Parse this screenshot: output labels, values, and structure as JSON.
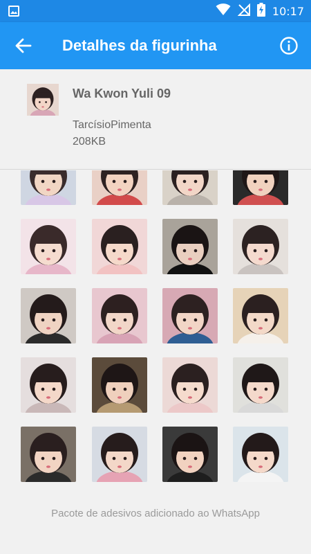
{
  "status_bar": {
    "time": "10:17"
  },
  "app_bar": {
    "title": "Detalhes da figurinha"
  },
  "pack": {
    "name": "Wa Kwon Yuli 09",
    "author": "TarcísioPimenta",
    "size": "208KB"
  },
  "footer": {
    "message": "Pacote de adesivos adicionado ao WhatsApp"
  },
  "colors": {
    "status_bar": "#1e88e5",
    "app_bar": "#2196f3",
    "background": "#f1f1f1",
    "text_secondary": "#666666"
  },
  "stickers": [
    {
      "bg": "#cfd6e2",
      "skin": "#f1d6c4",
      "hair": "#3a2c2c",
      "cloth": "#d8c7e6"
    },
    {
      "bg": "#e9d0c6",
      "skin": "#f3d3c1",
      "hair": "#2e2222",
      "cloth": "#d24b4b"
    },
    {
      "bg": "#d9d2c8",
      "skin": "#f2d6c7",
      "hair": "#2b2020",
      "cloth": "#b9b2aa"
    },
    {
      "bg": "#2a2a2a",
      "skin": "#f1d2bf",
      "hair": "#1f1717",
      "cloth": "#d05050"
    },
    {
      "bg": "#f3e3e8",
      "skin": "#f5dccf",
      "hair": "#3a2a2a",
      "cloth": "#e7b7c9"
    },
    {
      "bg": "#f1d7d7",
      "skin": "#f5d9ca",
      "hair": "#2a2020",
      "cloth": "#f2c2c2"
    },
    {
      "bg": "#a9a39a",
      "skin": "#e9cfc0",
      "hair": "#1a1414",
      "cloth": "#111111"
    },
    {
      "bg": "#e5e0dc",
      "skin": "#f4dace",
      "hair": "#2c2222",
      "cloth": "#c9c3c0"
    },
    {
      "bg": "#cfc9c4",
      "skin": "#efd3c2",
      "hair": "#241b1b",
      "cloth": "#2b2b2b"
    },
    {
      "bg": "#e8c7cf",
      "skin": "#f2d6c8",
      "hair": "#2d2020",
      "cloth": "#d8a3b5"
    },
    {
      "bg": "#d7a9b4",
      "skin": "#f2d5c6",
      "hair": "#2d2121",
      "cloth": "#2f5e93"
    },
    {
      "bg": "#e6d3b8",
      "skin": "#f3d9c8",
      "hair": "#2b2020",
      "cloth": "#f5f0ea"
    },
    {
      "bg": "#e5dede",
      "skin": "#f4d8c9",
      "hair": "#271d1d",
      "cloth": "#c9b8b8"
    },
    {
      "bg": "#5b4b3b",
      "skin": "#efd0bd",
      "hair": "#1e1616",
      "cloth": "#b59a72"
    },
    {
      "bg": "#ecd9d6",
      "skin": "#f5dbcd",
      "hair": "#2b2020",
      "cloth": "#ecc8c8"
    },
    {
      "bg": "#e0e0dc",
      "skin": "#f4d9cb",
      "hair": "#1f1818",
      "cloth": "#d9d9d9"
    },
    {
      "bg": "#7a7066",
      "skin": "#f2d4c3",
      "hair": "#2a1f1f",
      "cloth": "#2b2b2b"
    },
    {
      "bg": "#d6dbe3",
      "skin": "#f3d7c8",
      "hair": "#261c1c",
      "cloth": "#e6a3b4"
    },
    {
      "bg": "#3a3a3a",
      "skin": "#f1d2c0",
      "hair": "#1b1414",
      "cloth": "#1e1e1e"
    },
    {
      "bg": "#dbe4ea",
      "skin": "#f4d9ca",
      "hair": "#231a1a",
      "cloth": "#f4f4f4"
    }
  ]
}
